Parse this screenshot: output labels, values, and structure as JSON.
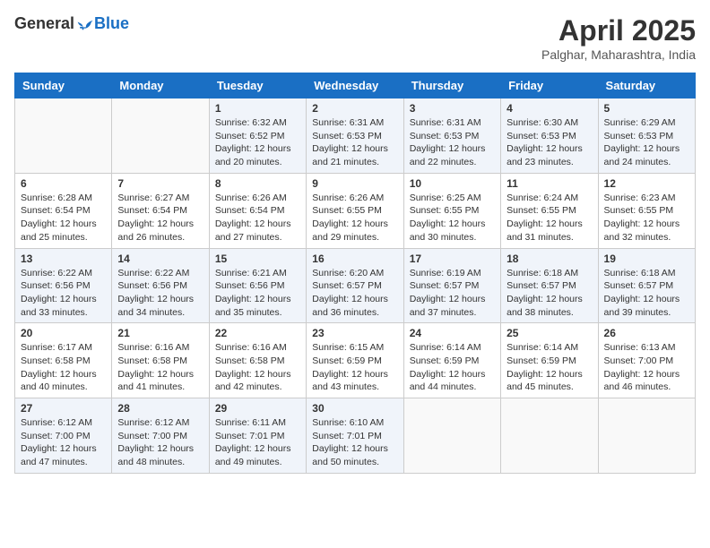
{
  "header": {
    "logo_general": "General",
    "logo_blue": "Blue",
    "month_title": "April 2025",
    "subtitle": "Palghar, Maharashtra, India"
  },
  "days_of_week": [
    "Sunday",
    "Monday",
    "Tuesday",
    "Wednesday",
    "Thursday",
    "Friday",
    "Saturday"
  ],
  "weeks": [
    [
      {
        "day": "",
        "info": ""
      },
      {
        "day": "",
        "info": ""
      },
      {
        "day": "1",
        "info": "Sunrise: 6:32 AM\nSunset: 6:52 PM\nDaylight: 12 hours and 20 minutes."
      },
      {
        "day": "2",
        "info": "Sunrise: 6:31 AM\nSunset: 6:53 PM\nDaylight: 12 hours and 21 minutes."
      },
      {
        "day": "3",
        "info": "Sunrise: 6:31 AM\nSunset: 6:53 PM\nDaylight: 12 hours and 22 minutes."
      },
      {
        "day": "4",
        "info": "Sunrise: 6:30 AM\nSunset: 6:53 PM\nDaylight: 12 hours and 23 minutes."
      },
      {
        "day": "5",
        "info": "Sunrise: 6:29 AM\nSunset: 6:53 PM\nDaylight: 12 hours and 24 minutes."
      }
    ],
    [
      {
        "day": "6",
        "info": "Sunrise: 6:28 AM\nSunset: 6:54 PM\nDaylight: 12 hours and 25 minutes."
      },
      {
        "day": "7",
        "info": "Sunrise: 6:27 AM\nSunset: 6:54 PM\nDaylight: 12 hours and 26 minutes."
      },
      {
        "day": "8",
        "info": "Sunrise: 6:26 AM\nSunset: 6:54 PM\nDaylight: 12 hours and 27 minutes."
      },
      {
        "day": "9",
        "info": "Sunrise: 6:26 AM\nSunset: 6:55 PM\nDaylight: 12 hours and 29 minutes."
      },
      {
        "day": "10",
        "info": "Sunrise: 6:25 AM\nSunset: 6:55 PM\nDaylight: 12 hours and 30 minutes."
      },
      {
        "day": "11",
        "info": "Sunrise: 6:24 AM\nSunset: 6:55 PM\nDaylight: 12 hours and 31 minutes."
      },
      {
        "day": "12",
        "info": "Sunrise: 6:23 AM\nSunset: 6:55 PM\nDaylight: 12 hours and 32 minutes."
      }
    ],
    [
      {
        "day": "13",
        "info": "Sunrise: 6:22 AM\nSunset: 6:56 PM\nDaylight: 12 hours and 33 minutes."
      },
      {
        "day": "14",
        "info": "Sunrise: 6:22 AM\nSunset: 6:56 PM\nDaylight: 12 hours and 34 minutes."
      },
      {
        "day": "15",
        "info": "Sunrise: 6:21 AM\nSunset: 6:56 PM\nDaylight: 12 hours and 35 minutes."
      },
      {
        "day": "16",
        "info": "Sunrise: 6:20 AM\nSunset: 6:57 PM\nDaylight: 12 hours and 36 minutes."
      },
      {
        "day": "17",
        "info": "Sunrise: 6:19 AM\nSunset: 6:57 PM\nDaylight: 12 hours and 37 minutes."
      },
      {
        "day": "18",
        "info": "Sunrise: 6:18 AM\nSunset: 6:57 PM\nDaylight: 12 hours and 38 minutes."
      },
      {
        "day": "19",
        "info": "Sunrise: 6:18 AM\nSunset: 6:57 PM\nDaylight: 12 hours and 39 minutes."
      }
    ],
    [
      {
        "day": "20",
        "info": "Sunrise: 6:17 AM\nSunset: 6:58 PM\nDaylight: 12 hours and 40 minutes."
      },
      {
        "day": "21",
        "info": "Sunrise: 6:16 AM\nSunset: 6:58 PM\nDaylight: 12 hours and 41 minutes."
      },
      {
        "day": "22",
        "info": "Sunrise: 6:16 AM\nSunset: 6:58 PM\nDaylight: 12 hours and 42 minutes."
      },
      {
        "day": "23",
        "info": "Sunrise: 6:15 AM\nSunset: 6:59 PM\nDaylight: 12 hours and 43 minutes."
      },
      {
        "day": "24",
        "info": "Sunrise: 6:14 AM\nSunset: 6:59 PM\nDaylight: 12 hours and 44 minutes."
      },
      {
        "day": "25",
        "info": "Sunrise: 6:14 AM\nSunset: 6:59 PM\nDaylight: 12 hours and 45 minutes."
      },
      {
        "day": "26",
        "info": "Sunrise: 6:13 AM\nSunset: 7:00 PM\nDaylight: 12 hours and 46 minutes."
      }
    ],
    [
      {
        "day": "27",
        "info": "Sunrise: 6:12 AM\nSunset: 7:00 PM\nDaylight: 12 hours and 47 minutes."
      },
      {
        "day": "28",
        "info": "Sunrise: 6:12 AM\nSunset: 7:00 PM\nDaylight: 12 hours and 48 minutes."
      },
      {
        "day": "29",
        "info": "Sunrise: 6:11 AM\nSunset: 7:01 PM\nDaylight: 12 hours and 49 minutes."
      },
      {
        "day": "30",
        "info": "Sunrise: 6:10 AM\nSunset: 7:01 PM\nDaylight: 12 hours and 50 minutes."
      },
      {
        "day": "",
        "info": ""
      },
      {
        "day": "",
        "info": ""
      },
      {
        "day": "",
        "info": ""
      }
    ]
  ]
}
